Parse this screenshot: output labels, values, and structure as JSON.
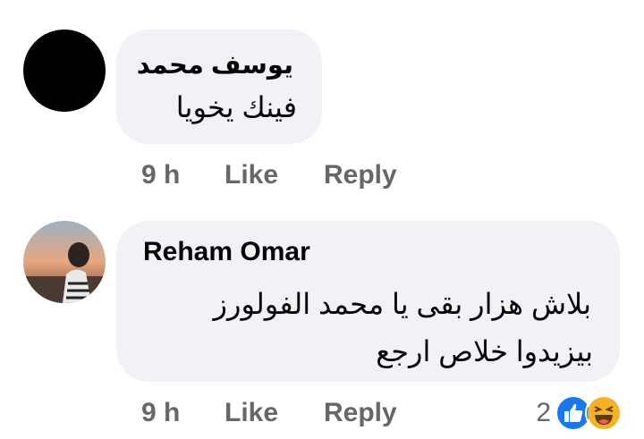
{
  "comments": [
    {
      "author": "يوسف محمد",
      "text_lines": [
        "فينك يخويا"
      ],
      "time": "9 h",
      "like_label": "Like",
      "reply_label": "Reply"
    },
    {
      "author": "Reham Omar",
      "text_lines": [
        "بلاش هزار بقى يا محمد الفولورز",
        "بيزيدوا خلاص ارجع"
      ],
      "time": "9 h",
      "like_label": "Like",
      "reply_label": "Reply",
      "reaction_count": "2",
      "reactions": [
        "like-reaction-icon",
        "haha-reaction-icon"
      ]
    }
  ],
  "colors": {
    "bubble": "#f0f2f5",
    "meta_text": "#65676b",
    "like_blue": "#1877f2",
    "haha_yellow": "#f7b125"
  }
}
